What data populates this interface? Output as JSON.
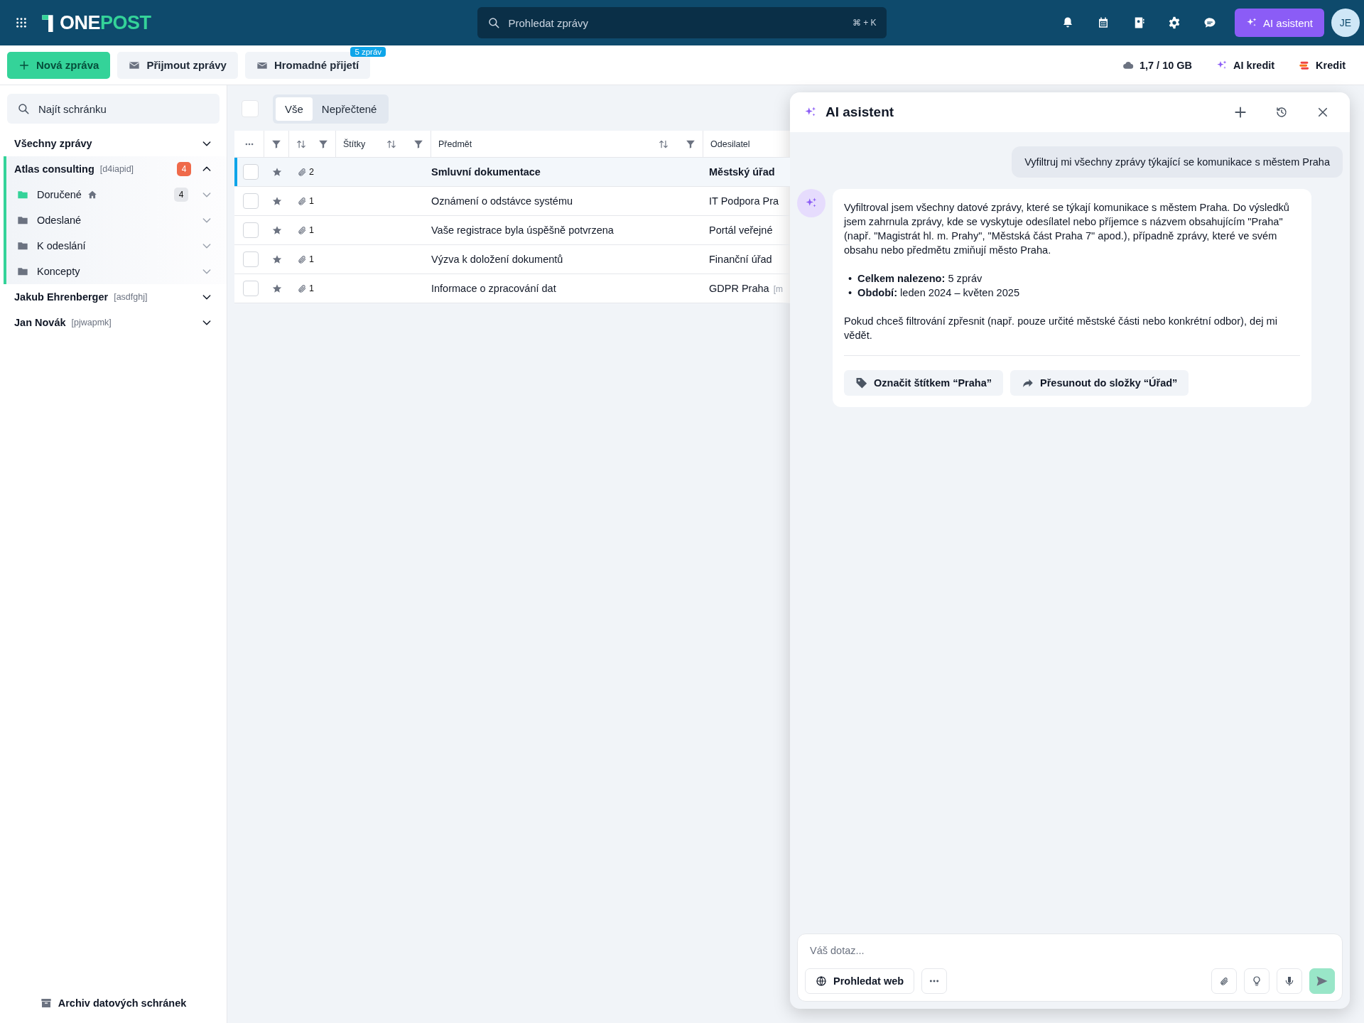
{
  "topbar": {
    "logo": {
      "first": "ONE",
      "second": "POST"
    },
    "search": {
      "placeholder": "Prohledat zprávy",
      "shortcut": "⌘ + K"
    },
    "ai_button": "AI asistent",
    "avatar": "JE"
  },
  "toolbar": {
    "buttons": [
      {
        "label": "Nová zpráva",
        "kind": "primary"
      },
      {
        "label": "Přijmout zprávy",
        "kind": "secondary"
      },
      {
        "label": "Hromadné přijetí",
        "kind": "secondary",
        "badge": "5 zpráv"
      }
    ],
    "storage": "1,7 / 10 GB",
    "ai_credit": "AI kredit",
    "credit": "Kredit"
  },
  "sidebar": {
    "search": {
      "placeholder": "Najít schránku"
    },
    "all_messages": {
      "label": "Všechny zprávy",
      "expanded": false
    },
    "mailboxes": [
      {
        "name": "Atlas consulting",
        "code": "[d4iapid]",
        "badge": "4",
        "expanded": true,
        "folders": [
          {
            "label": "Doručené",
            "count": "4",
            "home": true,
            "selected": true
          },
          {
            "label": "Odeslané",
            "home": false,
            "selected": false
          },
          {
            "label": "K odeslání",
            "home": false,
            "selected": false
          },
          {
            "label": "Koncepty",
            "home": false,
            "selected": false
          }
        ]
      },
      {
        "name": "Jakub Ehrenberger",
        "code": "[asdfghj]",
        "expanded": false
      },
      {
        "name": "Jan Novák",
        "code": "[pjwapmk]",
        "expanded": false
      }
    ],
    "footer": "Archiv datových schránek"
  },
  "select_all": {
    "checked": false
  },
  "filter_tabs": [
    {
      "label": "Vše",
      "selected": true
    },
    {
      "label": "Nepřečtené",
      "selected": false
    }
  ],
  "table": {
    "columns": [
      "Štítky",
      "Předmět",
      "Odesilatel"
    ],
    "rows": [
      {
        "checked": false,
        "attachments": "2",
        "subject": "Smluvní dokumentace",
        "sender": "Městský úřad",
        "unread": true,
        "selected": true
      },
      {
        "checked": false,
        "attachments": "1",
        "subject": "Oznámení o odstávce systému",
        "sender": "IT Podpora Pra",
        "unread": false,
        "selected": false
      },
      {
        "checked": false,
        "attachments": "1",
        "subject": "Vaše registrace byla úspěšně potvrzena",
        "sender": "Portál veřejné",
        "unread": false,
        "selected": false
      },
      {
        "checked": false,
        "attachments": "1",
        "subject": "Výzva k doložení dokumentů",
        "sender": "Finanční úřad",
        "unread": false,
        "selected": false
      },
      {
        "checked": false,
        "attachments": "1",
        "subject": "Informace o zpracování dat",
        "sender": "GDPR Praha",
        "sender_tag": "[m",
        "unread": false,
        "selected": false
      }
    ]
  },
  "ai_panel": {
    "title": "AI asistent",
    "user_message": "Vyfiltruj mi všechny zprávy týkající se komunikace s městem Praha",
    "reply": {
      "intro": "Vyfiltroval jsem všechny datové zprávy, které se týkají komunikace s městem Praha. Do výsledků jsem zahrnula zprávy, kde se vyskytuje odesílatel nebo příjemce s názvem obsahujícím \"Praha\" (např. \"Magistrát hl. m. Prahy\", \"Městská část Praha 7\" apod.), případně zprávy, které ve svém obsahu nebo předmětu zmiňují město Praha.",
      "bullets": [
        {
          "marker": "•",
          "text": "**Celkem nalezeno:** 5 zpráv"
        },
        {
          "marker": "•",
          "text": "**Období:** leden 2024 – květen 2025"
        }
      ],
      "outro": "Pokud chceš filtrování zpřesnit (např. pouze určité městské části nebo konkrétní odbor), dej mi vědět.",
      "actions": [
        {
          "label": "Označit štítkem “Praha”",
          "kind": "tag"
        },
        {
          "label": "Přesunout do složky “Úřad”",
          "kind": "move"
        }
      ]
    },
    "input": {
      "placeholder": "Váš dotaz...",
      "web_button": "Prohledat web"
    }
  }
}
